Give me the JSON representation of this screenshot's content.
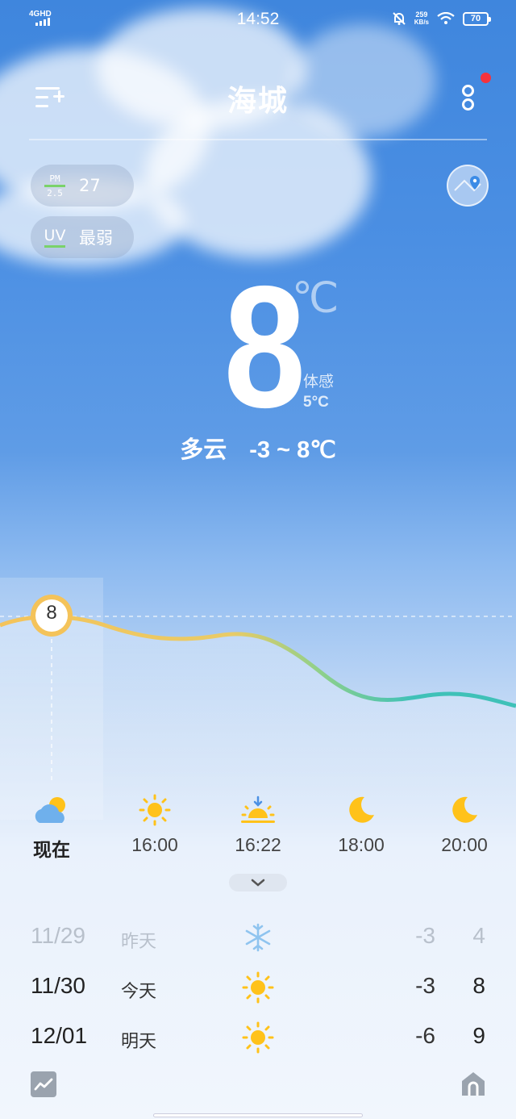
{
  "status_bar": {
    "network": "4GHD",
    "time": "14:52",
    "speed_value": "259",
    "speed_unit": "KB/s",
    "battery": "70"
  },
  "header": {
    "city": "海城",
    "notification_dot_color": "#f5323d"
  },
  "air": {
    "pm_label_top": "PM",
    "pm_label_bottom": "2.5",
    "pm_value": "27",
    "uv_label": "UV",
    "uv_value": "最弱"
  },
  "current": {
    "temp": "8",
    "unit": "℃",
    "feels_label": "体感",
    "feels_value": "5°C",
    "condition": "多云",
    "range": "-3 ~ 8℃"
  },
  "hourly": {
    "current_marker": "8",
    "items": [
      {
        "time": "现在",
        "icon": "partly-cloudy-icon"
      },
      {
        "time": "16:00",
        "icon": "sun-icon"
      },
      {
        "time": "16:22",
        "icon": "sunset-icon"
      },
      {
        "time": "18:00",
        "icon": "moon-icon"
      },
      {
        "time": "20:00",
        "icon": "moon-icon"
      }
    ]
  },
  "daily": [
    {
      "date": "11/29",
      "label": "昨天",
      "icon": "snowflake-icon",
      "low": "-3",
      "high": "4"
    },
    {
      "date": "11/30",
      "label": "今天",
      "icon": "sun-icon",
      "low": "-3",
      "high": "8"
    },
    {
      "date": "12/01",
      "label": "明天",
      "icon": "sun-icon",
      "low": "-6",
      "high": "9"
    }
  ],
  "colors": {
    "sun": "#ffc21a",
    "curve_warm": "#f4c35a",
    "curve_cool": "#3fc1b8"
  }
}
